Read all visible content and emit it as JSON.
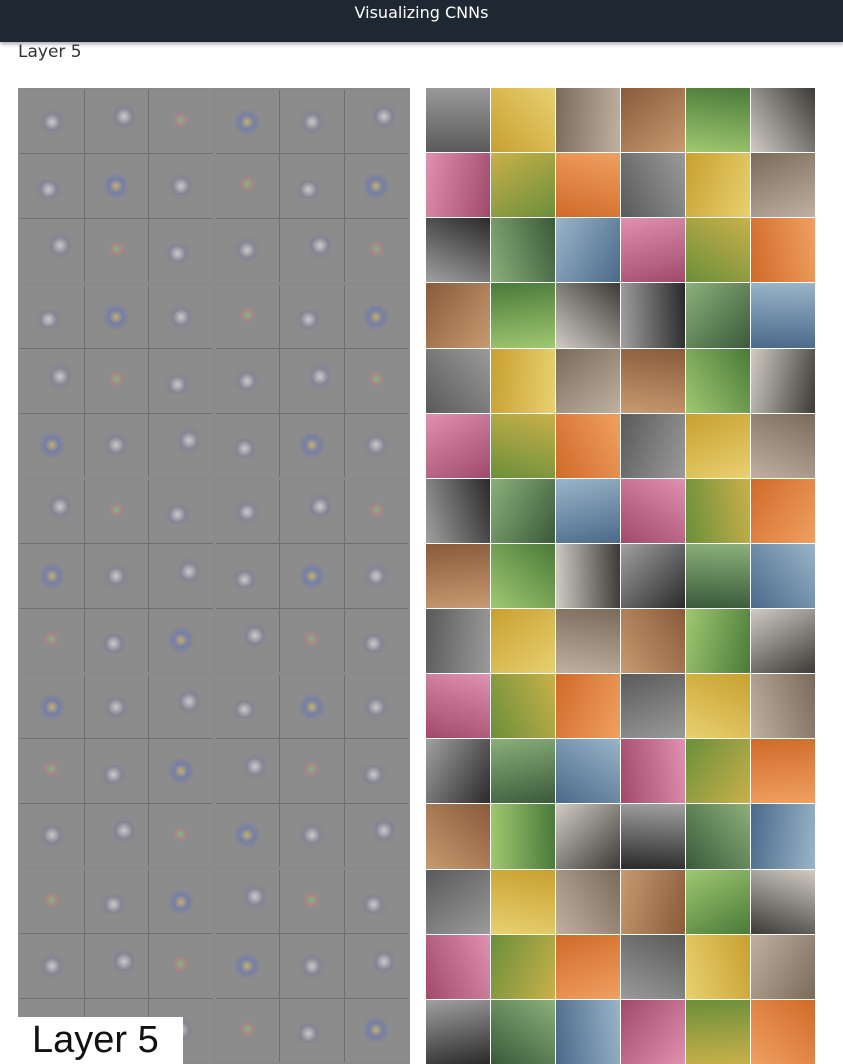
{
  "header": {
    "title": "Visualizing CNNs"
  },
  "section": {
    "heading": "Layer 5"
  },
  "slide": {
    "label": "Layer 5",
    "viz_panel": {
      "groups": 10,
      "tiles_per_group": 9
    },
    "image_panel": {
      "columns": 6,
      "rows": 15
    }
  }
}
